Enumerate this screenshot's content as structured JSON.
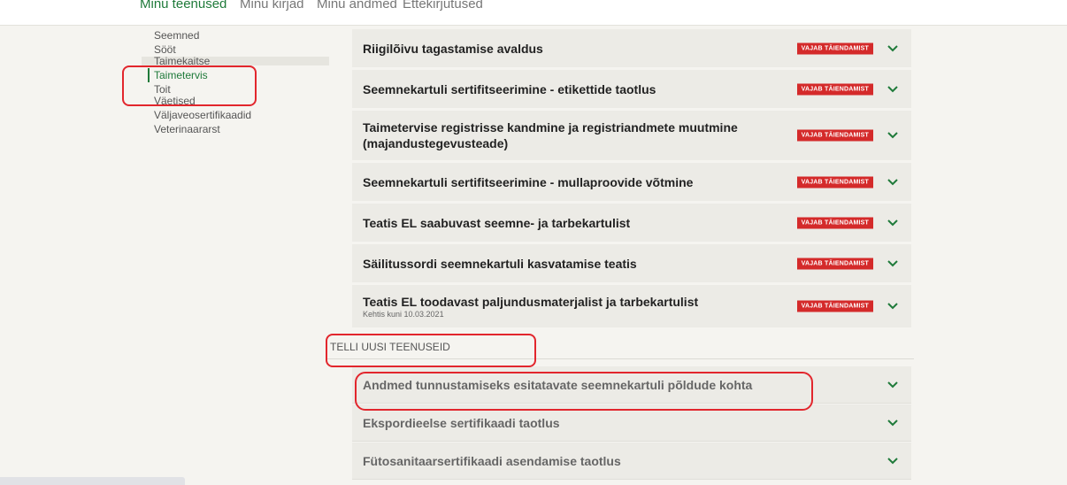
{
  "top_nav": {
    "tabs": [
      "Minu teenused",
      "Minu kirjad",
      "Minu andmed",
      "Ettekirjutused"
    ]
  },
  "sidebar": {
    "items": [
      "Seemned",
      "Sööt",
      "Taimekaitse",
      "Taimetervis",
      "Toit",
      "Väetised",
      "Väljaveosertifikaadid",
      "Veterinaararst"
    ]
  },
  "services": [
    {
      "title": "Riigilõivu tagastamise avaldus",
      "badge": "VAJAB TÄIENDAMIST"
    },
    {
      "title": "Seemnekartuli sertifitseerimine - etikettide taotlus",
      "badge": "VAJAB TÄIENDAMIST"
    },
    {
      "title": "Taimetervise registrisse kandmine ja registriandmete muutmine (majandustegevusteade)",
      "badge": "VAJAB TÄIENDAMIST"
    },
    {
      "title": "Seemnekartuli sertifitseerimine - mullaproovide võtmine",
      "badge": "VAJAB TÄIENDAMIST"
    },
    {
      "title": "Teatis EL saabuvast seemne- ja tarbekartulist",
      "badge": "VAJAB TÄIENDAMIST"
    },
    {
      "title": "Säilitussordi seemnekartuli kasvatamise teatis",
      "badge": "VAJAB TÄIENDAMIST"
    },
    {
      "title": "Teatis EL toodavast paljundusmaterjalist ja tarbekartulist",
      "subtitle": "Kehtis kuni 10.03.2021",
      "badge": "VAJAB TÄIENDAMIST"
    }
  ],
  "new_services": {
    "heading": "TELLI UUSI TEENUSEID",
    "items": [
      "Andmed tunnustamiseks esitatavate seemnekartuli põldude kohta",
      "Ekspordieelse sertifikaadi taotlus",
      "Fütosanitaarsertifikaadi asendamise taotlus"
    ]
  },
  "colors": {
    "accent_green": "#1f7a3a",
    "badge_red": "#d42a2a",
    "annotation_red": "#e2262d"
  },
  "icons": {
    "expand": "chevron-down-icon"
  }
}
